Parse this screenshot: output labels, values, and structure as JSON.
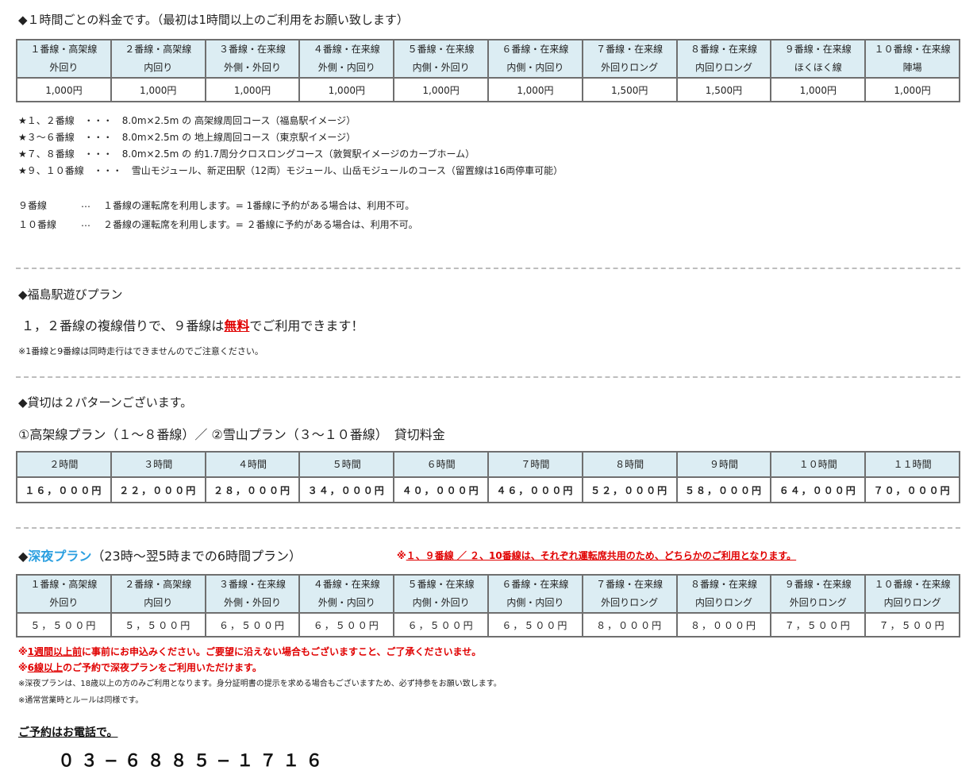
{
  "section1": {
    "title": "◆１時間ごとの料金です。（最初は1時間以上のご利用をお願い致します）",
    "table": {
      "headers": [
        [
          "１番線・高架線",
          "外回り"
        ],
        [
          "２番線・高架線",
          "内回り"
        ],
        [
          "３番線・在来線",
          "外側・外回り"
        ],
        [
          "４番線・在来線",
          "外側・内回り"
        ],
        [
          "５番線・在来線",
          "内側・外回り"
        ],
        [
          "６番線・在来線",
          "内側・内回り"
        ],
        [
          "７番線・在来線",
          "外回りロング"
        ],
        [
          "８番線・在来線",
          "内回りロング"
        ],
        [
          "９番線・在来線",
          "ほくほく線"
        ],
        [
          "１０番線・在来線",
          "陣場"
        ]
      ],
      "prices": [
        "1,000円",
        "1,000円",
        "1,000円",
        "1,000円",
        "1,000円",
        "1,000円",
        "1,500円",
        "1,500円",
        "1,000円",
        "1,000円"
      ]
    },
    "notes": [
      "★１、２番線　・・・　8.0m×2.5m の 高架線周回コース（福島駅イメージ）",
      "★３～６番線　・・・　8.0m×2.5m の 地上線周回コース（東京駅イメージ）",
      "★７、８番線　・・・　8.0m×2.5m の 約1.7周分クロスロングコース（敦賀駅イメージのカーブホーム）",
      "★９、１０番線　・・・　雪山モジュール、新疋田駅（12両）モジュール、山岳モジュールのコース（留置線は16両停車可能）"
    ],
    "line9": {
      "label": "９番線",
      "dots": "…",
      "text": "１番線の運転席を利用します。= 1番線に予約がある場合は、利用不可。"
    },
    "line10": {
      "label": "１０番線",
      "dots": "…",
      "text": "２番線の運転席を利用します。= ２番線に予約がある場合は、利用不可。"
    }
  },
  "section2": {
    "title": "◆福島駅遊びプラン",
    "lead_before": "１，２番線の複線借りで、９番線は",
    "lead_free": "無料",
    "lead_after": "でご利用できます！",
    "note": "※1番線と9番線は同時走行はできませんのでご注意ください。"
  },
  "section3": {
    "title": "◆貸切は２パターンございます。",
    "subtitle": "①高架線プラン（１～８番線）／ ②雪山プラン（３～１０番線）　貸切料金",
    "table": {
      "headers": [
        "２時間",
        "３時間",
        "４時間",
        "５時間",
        "６時間",
        "７時間",
        "８時間",
        "９時間",
        "１０時間",
        "１１時間"
      ],
      "prices": [
        "１６，０００円",
        "２２，０００円",
        "２８，０００円",
        "３４，０００円",
        "４０，０００円",
        "４６，０００円",
        "５２，０００円",
        "５８，０００円",
        "６４，０００円",
        "７０，０００円"
      ]
    }
  },
  "section4": {
    "diamond": "◆",
    "title": "深夜プラン",
    "subtitle": "（23時～翌5時までの6時間プラン）",
    "warn_prefix": "※",
    "warn": "１、９番線 ／ ２、10番線は、それぞれ運転席共用のため、どちらかのご利用となります。",
    "table": {
      "headers": [
        [
          "１番線・高架線",
          "外回り"
        ],
        [
          "２番線・高架線",
          "内回り"
        ],
        [
          "３番線・在来線",
          "外側・外回り"
        ],
        [
          "４番線・在来線",
          "外側・内回り"
        ],
        [
          "５番線・在来線",
          "内側・外回り"
        ],
        [
          "６番線・在来線",
          "内側・内回り"
        ],
        [
          "７番線・在来線",
          "外回りロング"
        ],
        [
          "８番線・在来線",
          "内回りロング"
        ],
        [
          "９番線・在来線",
          "外回りロング"
        ],
        [
          "１０番線・在来線",
          "内回りロング"
        ]
      ],
      "prices": [
        "５，５００円",
        "５，５００円",
        "６，５００円",
        "６，５００円",
        "６，５００円",
        "６，５００円",
        "８，０００円",
        "８，０００円",
        "７，５００円",
        "７，５００円"
      ]
    },
    "note1_prefix": "※",
    "note1_ul": "1週間以上前",
    "note1_rest": "に事前にお申込みください。ご要望に沿えない場合もございますこと、ご了承くださいませ。",
    "note2_prefix": "※",
    "note2_ul": "6線以上",
    "note2_rest": "のご予約で深夜プランをご利用いただけます。",
    "note3": "※深夜プランは、18歳以上の方のみご利用となります。身分証明書の提示を求める場合もございますため、必ず持参をお願い致します。",
    "note4": "※通常営業時とルールは同様です。"
  },
  "contact": {
    "label": "ご予約はお電話で。",
    "phone": "０３−６８８５−１７１６"
  },
  "colors": {
    "header_bg": "#dcedf3",
    "red": "#e00000",
    "blue": "#2b9fe0",
    "border": "#6f6f6f"
  }
}
